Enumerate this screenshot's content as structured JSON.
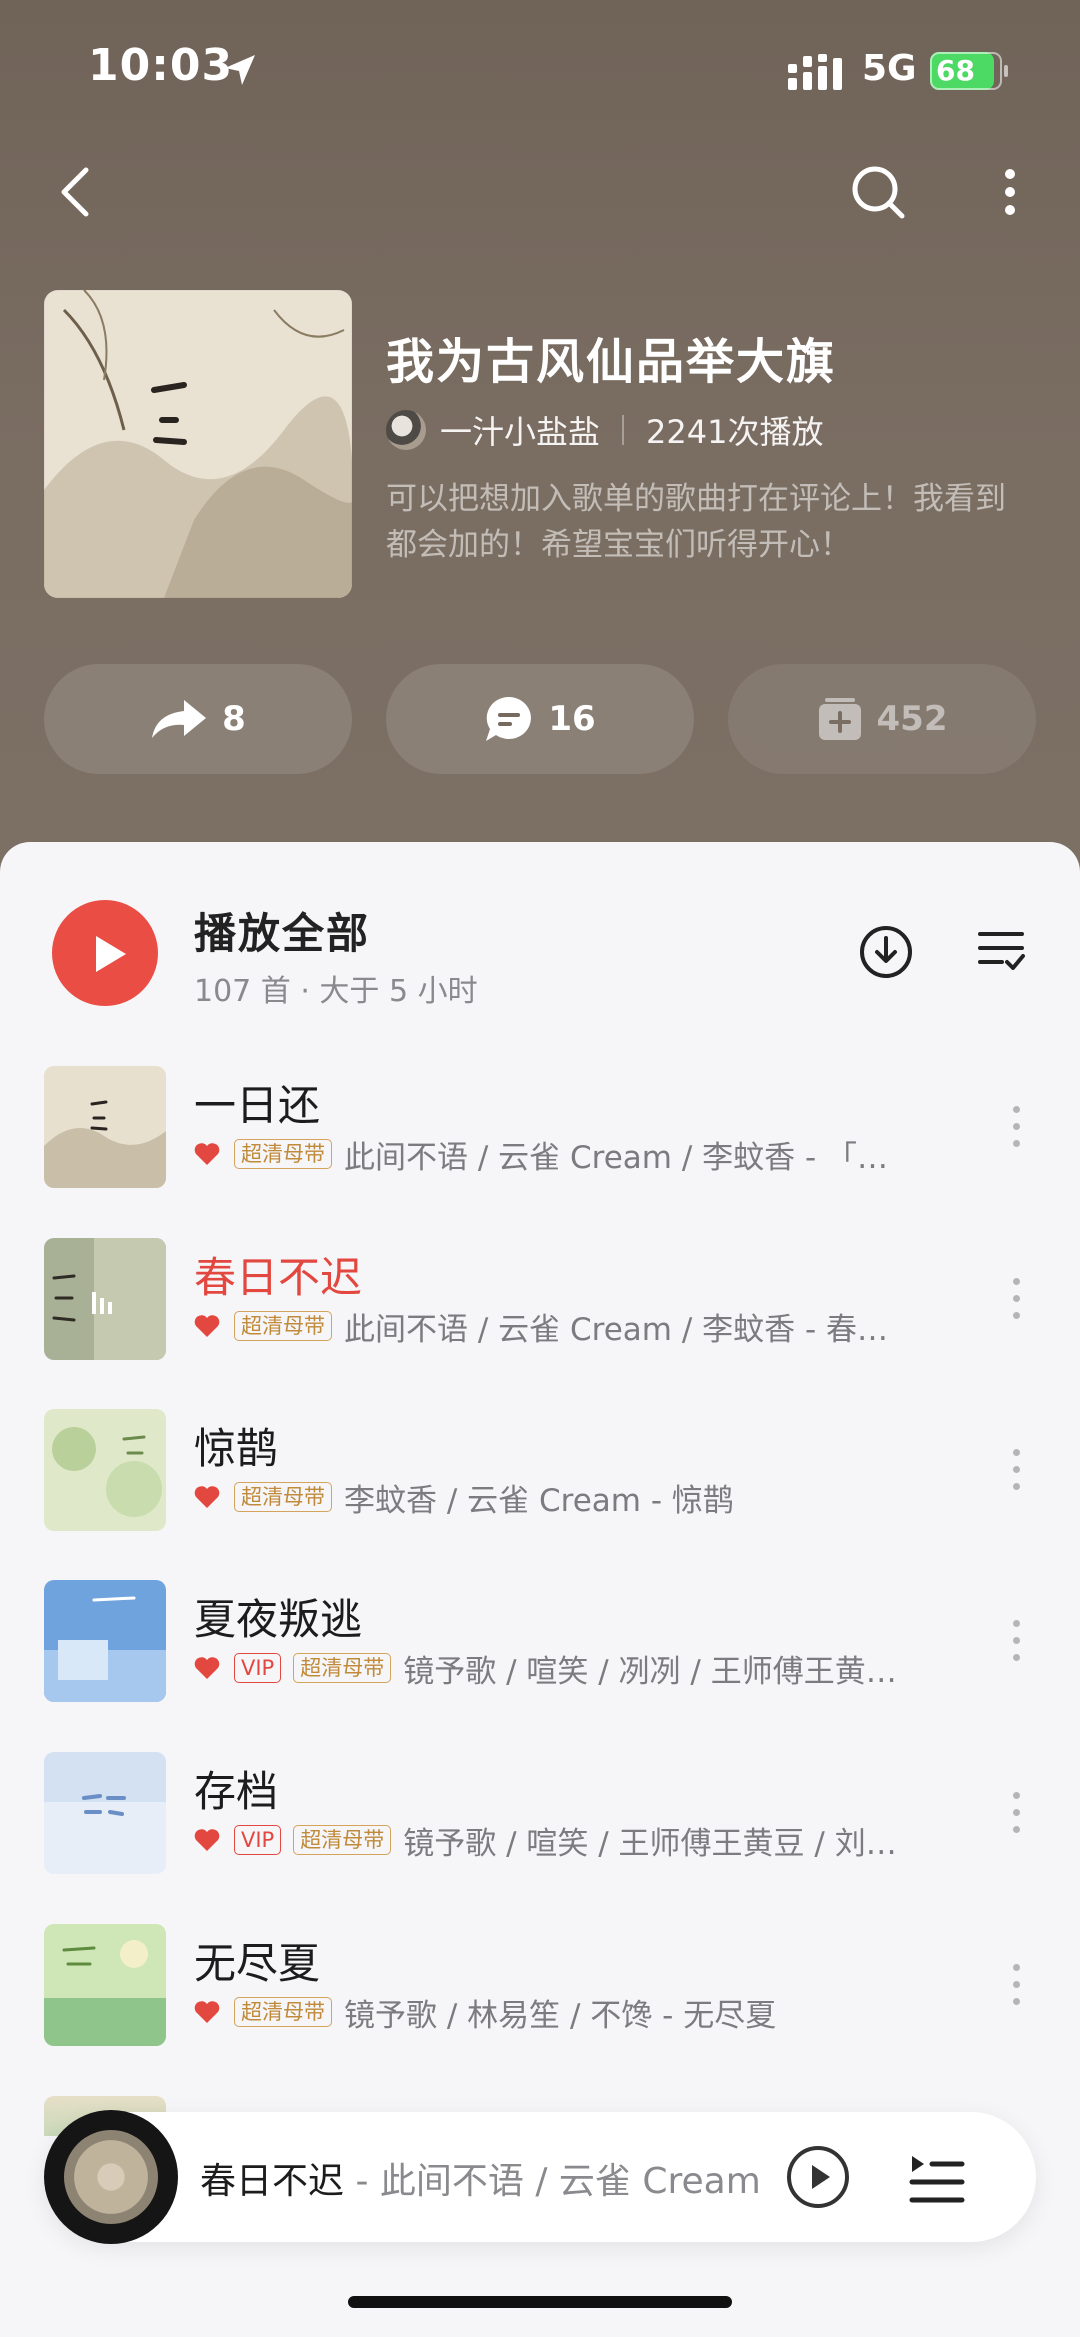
{
  "status": {
    "time": "10:03",
    "network": "5G",
    "battery": "68"
  },
  "playlist": {
    "title": "我为古风仙品举大旗",
    "creator": "一汁小盐盐",
    "plays": "2241次播放",
    "description": "可以把想加入歌单的歌曲打在评论上！我看到都会加的！希望宝宝们听得开心！",
    "share_count": "8",
    "comment_count": "16",
    "collect_count": "452"
  },
  "play_all": {
    "label": "播放全部",
    "sub": "107 首 · 大于 5 小时"
  },
  "tags": {
    "vip": "VIP",
    "hq": "超清母带"
  },
  "songs": [
    {
      "title": "一日还",
      "artist": "此间不语 / 云雀 Cream / 李蚊香 - 「…"
    },
    {
      "title": "春日不迟",
      "artist": "此间不语 / 云雀 Cream / 李蚊香 - 春…"
    },
    {
      "title": "惊鹊",
      "artist": "李蚊香 / 云雀 Cream - 惊鹊"
    },
    {
      "title": "夏夜叛逃",
      "artist": "镜予歌 / 喧笑 / 冽冽 / 王师傅王黄…"
    },
    {
      "title": "存档",
      "artist": "镜予歌 / 喧笑 / 王师傅王黄豆 / 刘…"
    },
    {
      "title": "无尽夏",
      "artist": "镜予歌 / 林易笙 / 不馋 - 无尽夏"
    }
  ],
  "now_playing": {
    "title": "春日不迟",
    "artist": " - 此间不语 / 云雀 Cream"
  },
  "colors": {
    "accent": "#ea4d44",
    "header": "#766a5f"
  }
}
